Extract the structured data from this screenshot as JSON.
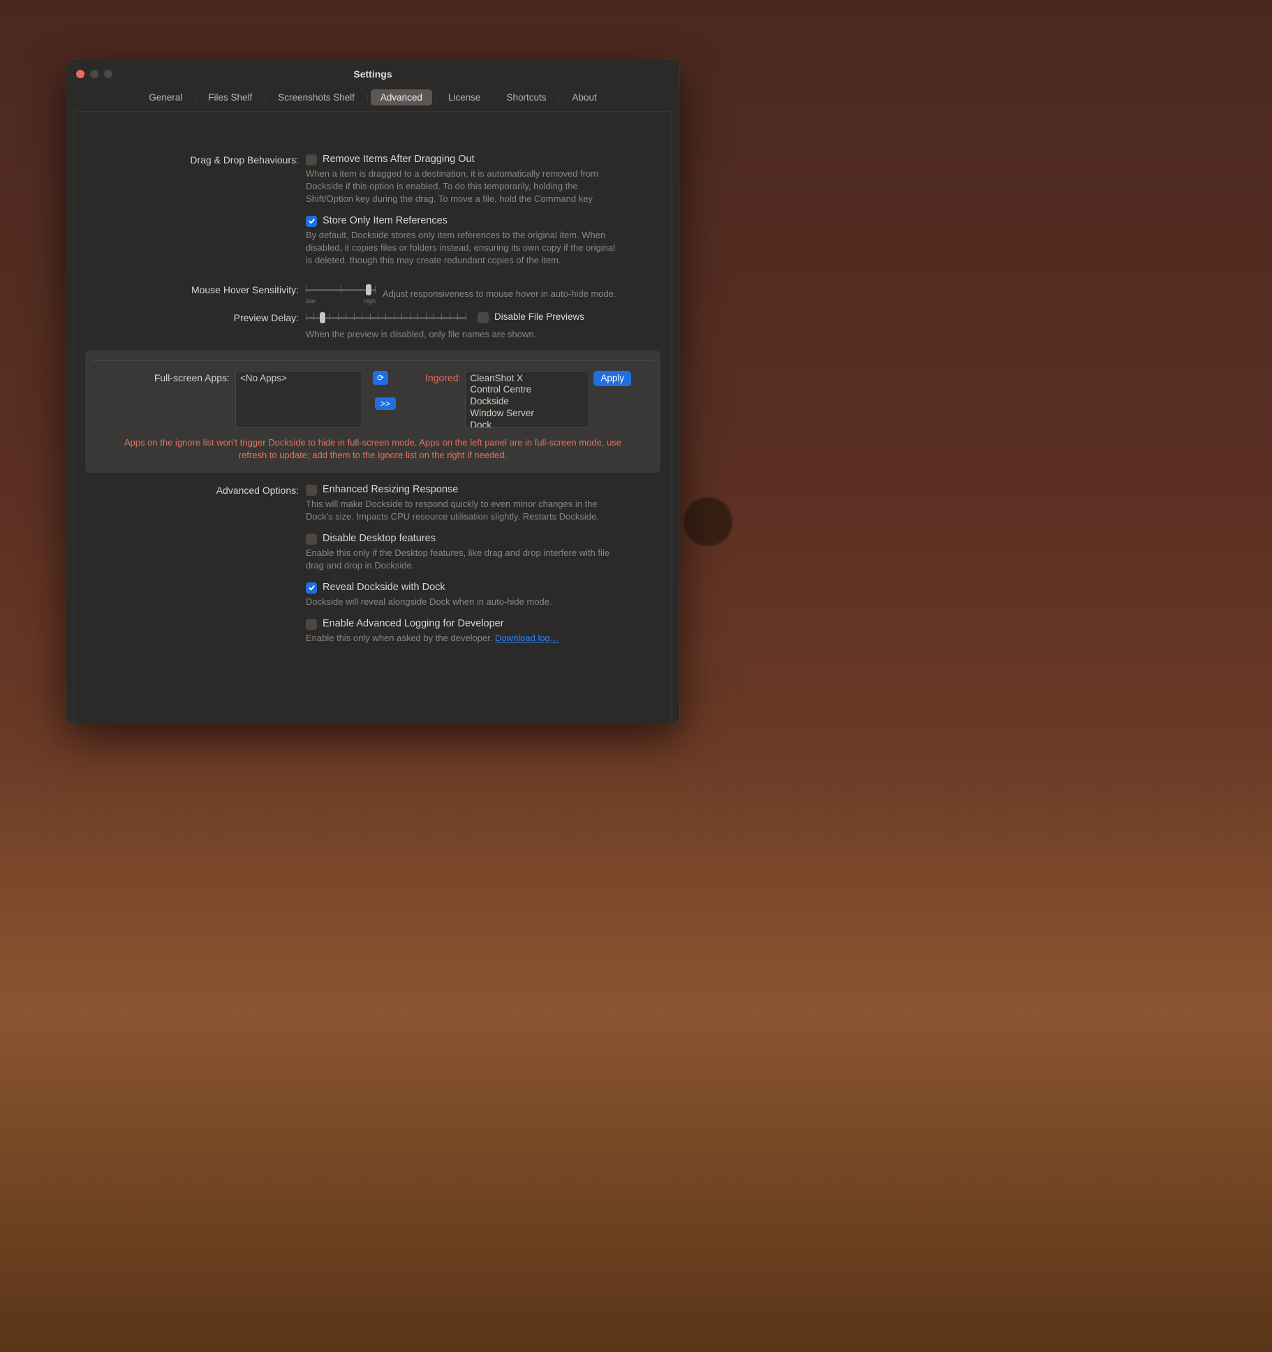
{
  "window": {
    "title": "Settings"
  },
  "tabs": {
    "items": [
      "General",
      "Files Shelf",
      "Screenshots Shelf",
      "Advanced",
      "License",
      "Shortcuts",
      "About"
    ],
    "active_index": 3
  },
  "sections": {
    "dragdrop": {
      "label": "Drag & Drop Behaviours:",
      "remove": {
        "checked": false,
        "title": "Remove Items After Dragging Out",
        "desc": "When a item is dragged to a destination, it is automatically removed from Dockside if this option is enabled. To do this temporarily, holding the Shift/Option key during the drag. To move a file, hold the Command key"
      },
      "store": {
        "checked": true,
        "title": "Store Only Item References",
        "desc": "By default, Dockside stores only item references to the original item. When disabled, it copies files or folders instead, ensuring its own copy if the original is deleted, though this may create redundant copies of the item."
      }
    },
    "hover": {
      "label": "Mouse Hover Sensitivity:",
      "low": "low",
      "high": "high",
      "value_pct": 88,
      "hint": "Adjust responsiveness to mouse hover in auto-hide mode."
    },
    "preview": {
      "label": "Preview Delay:",
      "value_pct": 10,
      "disable": {
        "checked": false,
        "title": "Disable File Previews"
      },
      "hint": "When the preview is disabled, only file names are shown."
    },
    "fullscreen": {
      "label": "Full-screen Apps:",
      "left_items": [
        "<No Apps>"
      ],
      "refresh_icon": "⟳",
      "transfer_label": ">>",
      "ignored_label": "Ingored:",
      "right_items": [
        "CleanShot X",
        "Control Centre",
        "Dockside",
        "Window Server",
        "Dock"
      ],
      "apply_label": "Apply",
      "desc": "Apps on the ignore list won't trigger Dockside to hide in full-screen mode. Apps on the left panel are in full-screen mode, use refresh to update; add them to the ignore list on the right if needed."
    },
    "advanced": {
      "label": "Advanced Options:",
      "resize": {
        "checked": false,
        "title": "Enhanced Resizing Response",
        "desc": "This will make Dockside to respond quickly to even minor changes in the Dock's size. Impacts CPU resource utilisation slightly. Restarts Dockside."
      },
      "desktop": {
        "checked": false,
        "title": "Disable Desktop features",
        "desc": "Enable this only if the Desktop features, like drag and drop interfere with file drag and drop in Dockside."
      },
      "reveal": {
        "checked": true,
        "title": "Reveal Dockside with Dock",
        "desc": "Dockside will reveal alongside Dock when in auto-hide mode."
      },
      "logging": {
        "checked": false,
        "title": "Enable Advanced Logging for Developer",
        "desc_prefix": "Enable this only when asked by the developer. ",
        "link": "Download log…"
      }
    }
  }
}
